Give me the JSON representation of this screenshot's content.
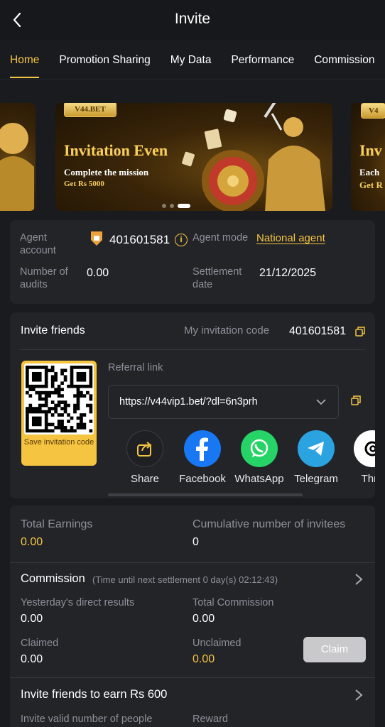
{
  "header": {
    "title": "Invite"
  },
  "tabs": [
    "Home",
    "Promotion Sharing",
    "My Data",
    "Performance",
    "Commission"
  ],
  "banner": {
    "badge": "V44.BET",
    "headline": "Invitation Even",
    "subline1": "Complete the mission",
    "subline2": "Get Rs 5000",
    "right_headline": "Inv",
    "right_sub1": "Each",
    "right_sub2": "Get R",
    "badge_right": "V4"
  },
  "agent": {
    "account_label": "Agent\naccount",
    "account_value": "401601581",
    "mode_label": "Agent mode",
    "mode_value": "National agent",
    "audits_label": "Number of\naudits",
    "audits_value": "0.00",
    "settlement_label": "Settlement\ndate",
    "settlement_value": "21/12/2025"
  },
  "invite": {
    "title": "Invite friends",
    "code_label": "My invitation code",
    "code_value": "401601581",
    "qr_save_label": "Save invitation code",
    "referral_label": "Referral link",
    "referral_url": "https://v44vip1.bet/?dl=6n3prh",
    "share": [
      "Share",
      "Facebook",
      "WhatsApp",
      "Telegram",
      "Thre"
    ]
  },
  "earnings": {
    "total_label": "Total Earnings",
    "total_value": "0.00",
    "cumulative_label": "Cumulative number of invitees",
    "cumulative_value": "0"
  },
  "commission": {
    "title": "Commission",
    "note": "(Time until next settlement 0 day(s) 02:12:43)",
    "yesterday_label": "Yesterday's direct results",
    "yesterday_value": "0.00",
    "total_label": "Total Commission",
    "total_value": "0.00",
    "claimed_label": "Claimed",
    "claimed_value": "0.00",
    "unclaimed_label": "Unclaimed",
    "unclaimed_value": "0.00",
    "claim_button": "Claim"
  },
  "earn": {
    "title": "Invite friends to earn Rs 600",
    "valid_label": "Invite valid number of people",
    "reward_label": "Reward"
  },
  "colors": {
    "accent": "#f5c542",
    "background": "#1a1b1f",
    "card": "#232428"
  }
}
